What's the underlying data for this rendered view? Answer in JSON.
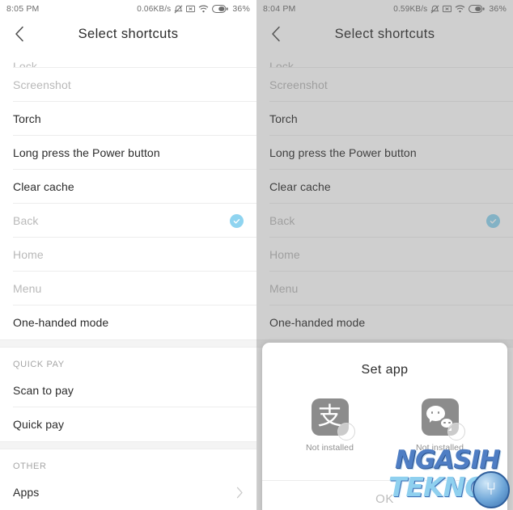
{
  "left_screen": {
    "status_bar": {
      "time": "8:05 PM",
      "network_speed": "0.06KB/s",
      "icons": [
        "silent-icon",
        "sim-icon",
        "wifi-icon",
        "battery-icon"
      ],
      "battery_percent": "36%"
    },
    "app_bar": {
      "back_icon": "back-chevron-icon",
      "title": "Select  shortcuts"
    },
    "list": [
      {
        "label": "Lock",
        "disabled": true,
        "checked": false,
        "clipped": true
      },
      {
        "label": "Screenshot",
        "disabled": true,
        "checked": false
      },
      {
        "label": "Torch",
        "disabled": false,
        "checked": false
      },
      {
        "label": "Long press the Power button",
        "disabled": false,
        "checked": false
      },
      {
        "label": "Clear cache",
        "disabled": false,
        "checked": false
      },
      {
        "label": "Back",
        "disabled": true,
        "checked": true
      },
      {
        "label": "Home",
        "disabled": true,
        "checked": false
      },
      {
        "label": "Menu",
        "disabled": true,
        "checked": false
      },
      {
        "label": "One-handed mode",
        "disabled": false,
        "checked": false
      }
    ],
    "section_quick_pay": {
      "header": "QUICK PAY",
      "items": [
        {
          "label": "Scan to pay"
        },
        {
          "label": "Quick pay"
        }
      ]
    },
    "section_other": {
      "header": "OTHER",
      "items": [
        {
          "label": "Apps",
          "chevron": "chevron-right-icon"
        }
      ]
    }
  },
  "right_screen": {
    "status_bar": {
      "time": "8:04 PM",
      "network_speed": "0.59KB/s",
      "icons": [
        "silent-icon",
        "sim-icon",
        "wifi-icon",
        "battery-icon"
      ],
      "battery_percent": "36%"
    },
    "app_bar": {
      "back_icon": "back-chevron-icon",
      "title": "Select  shortcuts"
    },
    "list": [
      {
        "label": "Lock",
        "disabled": true,
        "checked": false,
        "clipped": true
      },
      {
        "label": "Screenshot",
        "disabled": true,
        "checked": false
      },
      {
        "label": "Torch",
        "disabled": false,
        "checked": false
      },
      {
        "label": "Long press the Power button",
        "disabled": false,
        "checked": false
      },
      {
        "label": "Clear cache",
        "disabled": false,
        "checked": false
      },
      {
        "label": "Back",
        "disabled": true,
        "checked": true
      },
      {
        "label": "Home",
        "disabled": true,
        "checked": false
      },
      {
        "label": "Menu",
        "disabled": true,
        "checked": false
      },
      {
        "label": "One-handed mode",
        "disabled": false,
        "checked": false
      }
    ],
    "dialog": {
      "title": "Set app",
      "apps": [
        {
          "icon": "alipay-icon",
          "glyph": "支",
          "caption": "Not installed"
        },
        {
          "icon": "wechat-icon",
          "glyph": "",
          "caption": "Not installed"
        }
      ],
      "ok_label": "OK"
    }
  },
  "watermark": {
    "line1": "NGASIH",
    "line2": "TEKNO",
    "logo": "usb-logo-icon",
    "logo_glyph": "⑂"
  },
  "colors": {
    "accent_check": "#8fd4f0",
    "text_primary": "#2b2b2b",
    "text_disabled": "#b9b9b9",
    "divider": "#ededed",
    "section_header": "#a6a6a6",
    "dim_overlay": "#6b6b6b"
  }
}
